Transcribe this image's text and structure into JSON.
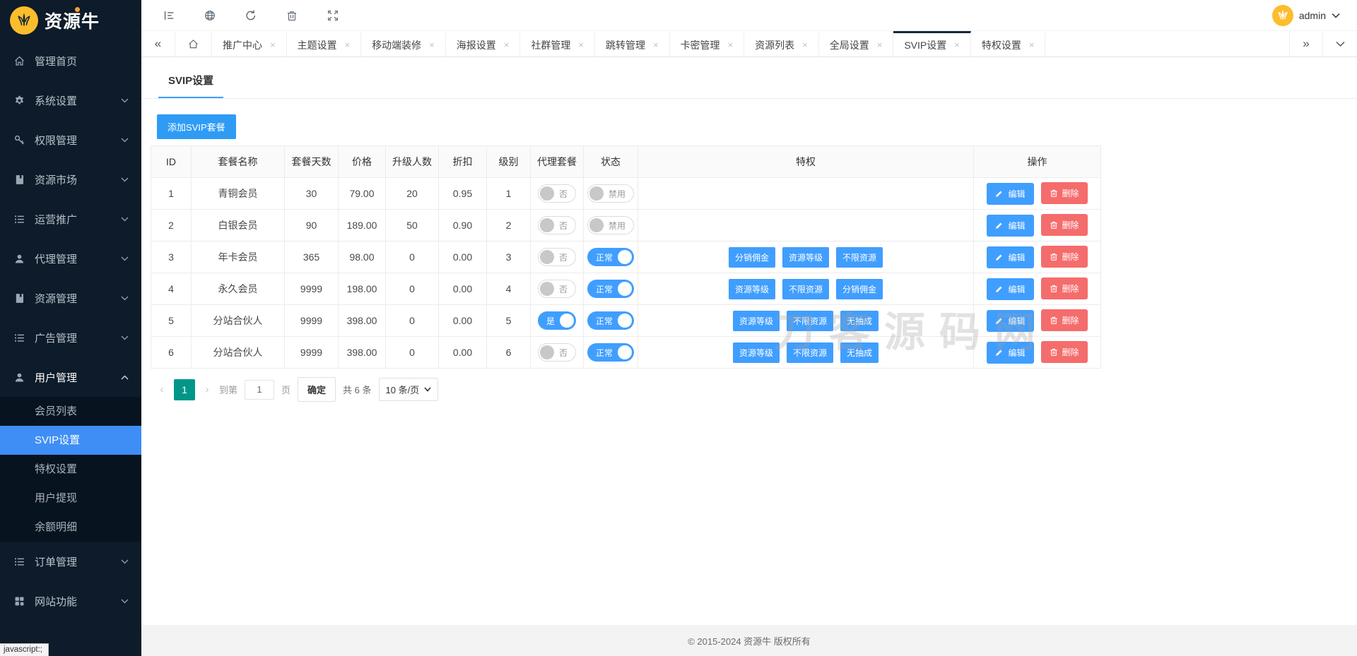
{
  "brand": {
    "name": "资源牛"
  },
  "admin": {
    "username": "admin"
  },
  "toolbar": {
    "icons": [
      {
        "name": "menu-collapse"
      },
      {
        "name": "globe"
      },
      {
        "name": "refresh"
      },
      {
        "name": "trash"
      },
      {
        "name": "fullscreen"
      }
    ]
  },
  "tabs": {
    "controls": {
      "scroll_left": "«",
      "scroll_right": "»",
      "close_glyph": "×"
    },
    "items": [
      {
        "key": "promotion-center",
        "label": "推广中心"
      },
      {
        "key": "theme-settings",
        "label": "主题设置"
      },
      {
        "key": "mobile-decoration",
        "label": "移动端装修"
      },
      {
        "key": "poster-settings",
        "label": "海报设置"
      },
      {
        "key": "community-management",
        "label": "社群管理"
      },
      {
        "key": "redirect-management",
        "label": "跳转管理"
      },
      {
        "key": "card-key-management",
        "label": "卡密管理"
      },
      {
        "key": "resource-list",
        "label": "资源列表"
      },
      {
        "key": "global-settings",
        "label": "全局设置"
      },
      {
        "key": "svip-settings",
        "label": "SVIP设置",
        "active": true
      },
      {
        "key": "privilege-settings",
        "label": "特权设置"
      }
    ]
  },
  "sidebar": {
    "items": [
      {
        "key": "admin-home",
        "label": "管理首页",
        "icon": "home"
      },
      {
        "key": "system-settings",
        "label": "系统设置",
        "icon": "gear",
        "chevron": "down"
      },
      {
        "key": "permission-management",
        "label": "权限管理",
        "icon": "key",
        "chevron": "down"
      },
      {
        "key": "resource-market",
        "label": "资源市场",
        "icon": "book",
        "chevron": "down"
      },
      {
        "key": "operation-promotion",
        "label": "运营推广",
        "icon": "list",
        "chevron": "down"
      },
      {
        "key": "agent-management",
        "label": "代理管理",
        "icon": "user",
        "chevron": "down"
      },
      {
        "key": "resource-management",
        "label": "资源管理",
        "icon": "book",
        "chevron": "down"
      },
      {
        "key": "ad-management",
        "label": "广告管理",
        "icon": "list",
        "chevron": "down"
      },
      {
        "key": "user-management",
        "label": "用户管理",
        "icon": "user",
        "chevron": "up",
        "expanded": true,
        "children": [
          {
            "key": "member-list",
            "label": "会员列表"
          },
          {
            "key": "svip-settings",
            "label": "SVIP设置",
            "active": true
          },
          {
            "key": "privilege-settings",
            "label": "特权设置"
          },
          {
            "key": "user-withdraw",
            "label": "用户提现"
          },
          {
            "key": "balance-details",
            "label": "余额明细"
          }
        ]
      },
      {
        "key": "order-management",
        "label": "订单管理",
        "icon": "list",
        "chevron": "down"
      },
      {
        "key": "site-features",
        "label": "网站功能",
        "icon": "grid",
        "chevron": "down"
      }
    ]
  },
  "page": {
    "title": "SVIP设置",
    "add_button": "添加SVIP套餐"
  },
  "table": {
    "headers": [
      {
        "key": "id",
        "label": "ID"
      },
      {
        "key": "package-name",
        "label": "套餐名称"
      },
      {
        "key": "package-days",
        "label": "套餐天数"
      },
      {
        "key": "price",
        "label": "价格"
      },
      {
        "key": "upgrade-count",
        "label": "升级人数"
      },
      {
        "key": "discount",
        "label": "折扣"
      },
      {
        "key": "level",
        "label": "级别"
      },
      {
        "key": "agent-package",
        "label": "代理套餐"
      },
      {
        "key": "status",
        "label": "状态"
      },
      {
        "key": "privileges",
        "label": "特权"
      },
      {
        "key": "actions",
        "label": "操作"
      }
    ],
    "actions": {
      "edit": "编辑",
      "delete": "删除"
    },
    "rows": [
      {
        "id": "1",
        "name": "青铜会员",
        "days": "30",
        "price": "79.00",
        "upgrade": "20",
        "discount": "0.95",
        "level": "1",
        "agent": {
          "on": false,
          "label": "否"
        },
        "status": {
          "on": false,
          "label": "禁用"
        },
        "privileges": []
      },
      {
        "id": "2",
        "name": "白银会员",
        "days": "90",
        "price": "189.00",
        "upgrade": "50",
        "discount": "0.90",
        "level": "2",
        "agent": {
          "on": false,
          "label": "否"
        },
        "status": {
          "on": false,
          "label": "禁用"
        },
        "privileges": []
      },
      {
        "id": "3",
        "name": "年卡会员",
        "days": "365",
        "price": "98.00",
        "upgrade": "0",
        "discount": "0.00",
        "level": "3",
        "agent": {
          "on": false,
          "label": "否"
        },
        "status": {
          "on": true,
          "label": "正常"
        },
        "privileges": [
          "分销佣金",
          "资源等级",
          "不限资源"
        ]
      },
      {
        "id": "4",
        "name": "永久会员",
        "days": "9999",
        "price": "198.00",
        "upgrade": "0",
        "discount": "0.00",
        "level": "4",
        "agent": {
          "on": false,
          "label": "否"
        },
        "status": {
          "on": true,
          "label": "正常"
        },
        "privileges": [
          "资源等级",
          "不限资源",
          "分销佣金"
        ]
      },
      {
        "id": "5",
        "name": "分站合伙人",
        "days": "9999",
        "price": "398.00",
        "upgrade": "0",
        "discount": "0.00",
        "level": "5",
        "agent": {
          "on": true,
          "label": "是"
        },
        "status": {
          "on": true,
          "label": "正常"
        },
        "privileges": [
          "资源等级",
          "不限资源",
          "无抽成"
        ]
      },
      {
        "id": "6",
        "name": "分站合伙人",
        "days": "9999",
        "price": "398.00",
        "upgrade": "0",
        "discount": "0.00",
        "level": "6",
        "agent": {
          "on": false,
          "label": "否"
        },
        "status": {
          "on": true,
          "label": "正常"
        },
        "privileges": [
          "资源等级",
          "不限资源",
          "无抽成"
        ]
      }
    ]
  },
  "pagination": {
    "prev_glyph": "‹",
    "next_glyph": "›",
    "current": "1",
    "goto_prefix": "到第",
    "goto_value": "1",
    "goto_suffix": "页",
    "confirm": "确定",
    "total": "共 6 条",
    "page_size": "10 条/页"
  },
  "watermark": {
    "text": "刀客源码网"
  },
  "footer": {
    "copyright": "© 2015-2024 资源牛 版权所有"
  },
  "status_bar": {
    "text": "javascript:;"
  },
  "colors": {
    "accent_blue": "#409eff",
    "danger_red": "#f56c6c",
    "pagination_green": "#009688",
    "sidebar_active": "#3f8ef6",
    "brand_yellow": "#fcbd2c",
    "sidebar_bg": "#0d1b2a"
  }
}
